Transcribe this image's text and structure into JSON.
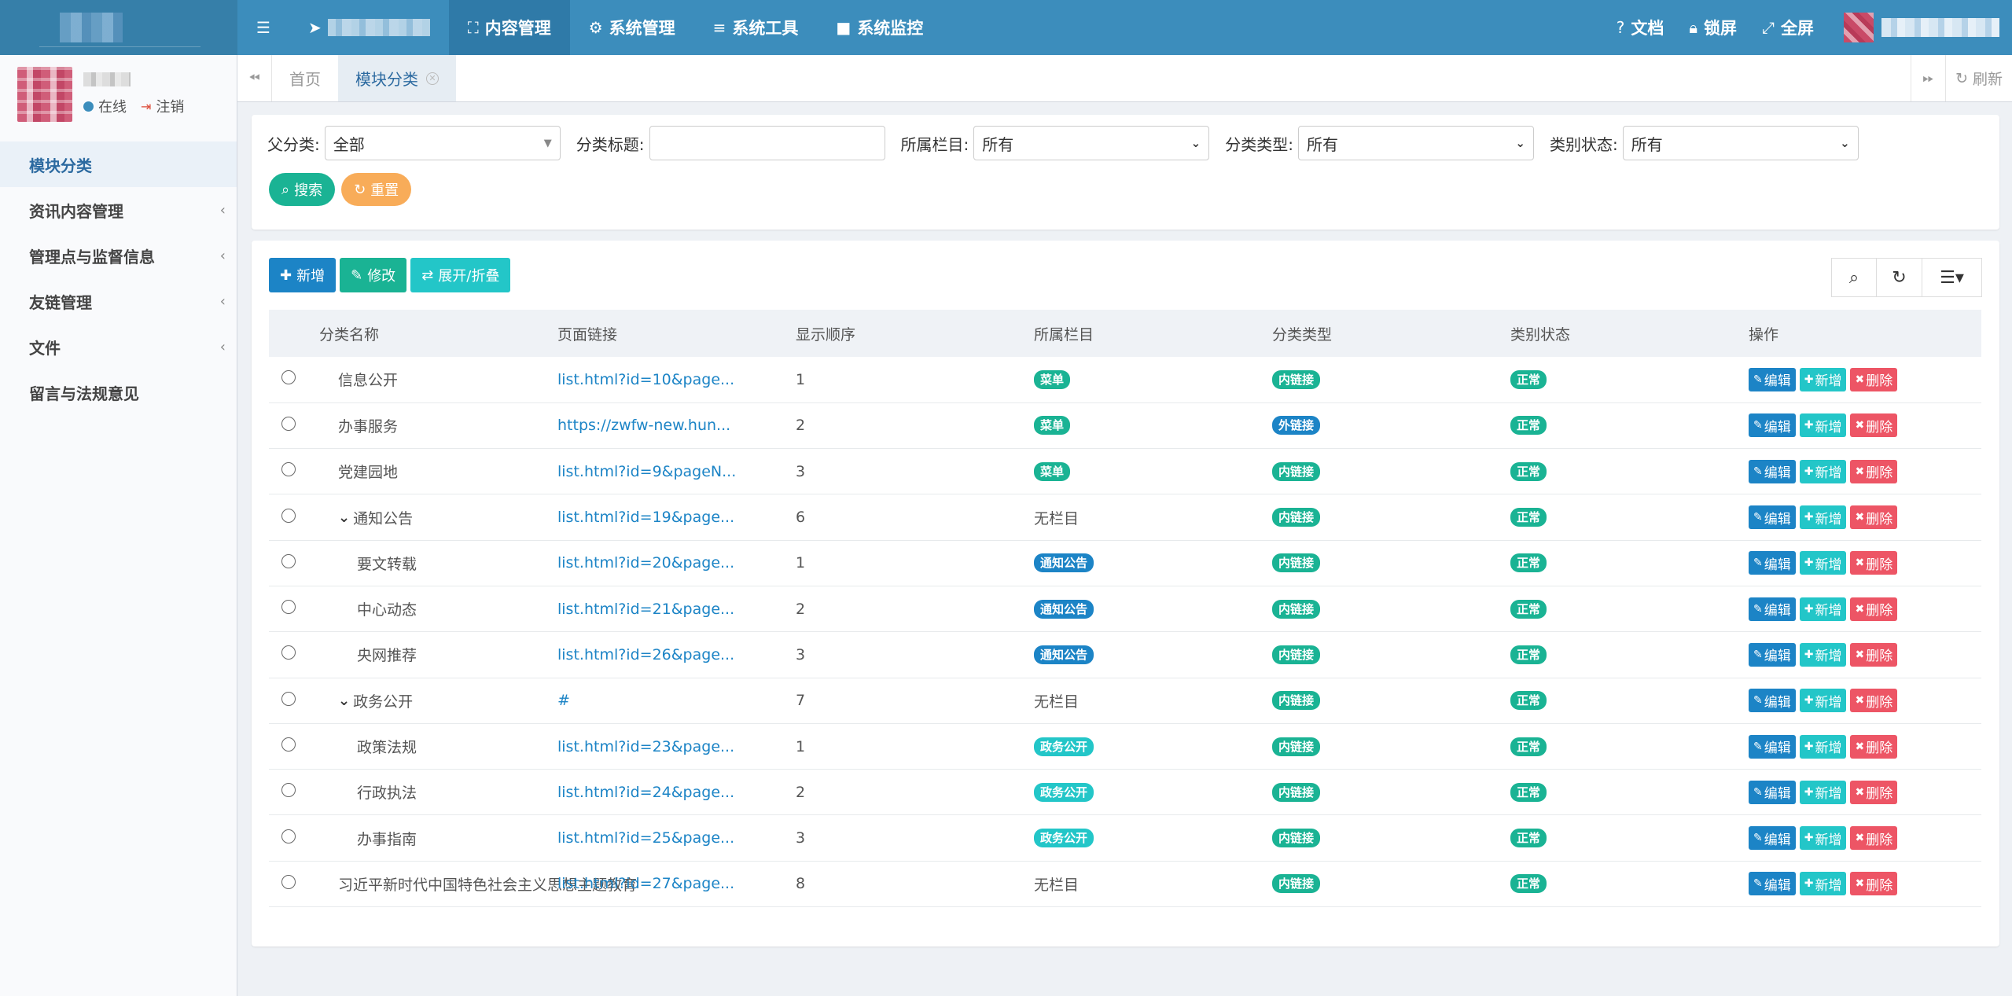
{
  "topbar": {
    "nav": [
      {
        "label": "内容管理",
        "icon": "content-icon"
      },
      {
        "label": "系统管理",
        "icon": "gear-icon"
      },
      {
        "label": "系统工具",
        "icon": "list-icon"
      },
      {
        "label": "系统监控",
        "icon": "camera-icon"
      }
    ],
    "right": [
      {
        "label": "文档",
        "icon": "question-icon"
      },
      {
        "label": "锁屏",
        "icon": "lock-icon"
      },
      {
        "label": "全屏",
        "icon": "fullscreen-icon"
      }
    ]
  },
  "sidebar": {
    "status_online": "在线",
    "logout": "注销",
    "items": [
      {
        "label": "模块分类",
        "active": true,
        "has_children": false
      },
      {
        "label": "资讯内容管理",
        "active": false,
        "has_children": true
      },
      {
        "label": "管理点与监督信息",
        "active": false,
        "has_children": true
      },
      {
        "label": "友链管理",
        "active": false,
        "has_children": true
      },
      {
        "label": "文件",
        "active": false,
        "has_children": true
      },
      {
        "label": "留言与法规意见",
        "active": false,
        "has_children": false
      }
    ]
  },
  "tabs": {
    "home": "首页",
    "current": "模块分类",
    "refresh": "刷新"
  },
  "search": {
    "parent_label": "父分类:",
    "parent_value": "全部",
    "title_label": "分类标题:",
    "title_value": "",
    "column_label": "所属栏目:",
    "column_value": "所有",
    "type_label": "分类类型:",
    "type_value": "所有",
    "status_label": "类别状态:",
    "status_value": "所有",
    "search_btn": "搜索",
    "reset_btn": "重置"
  },
  "toolbar": {
    "add": "新增",
    "edit": "修改",
    "expand": "展开/折叠"
  },
  "table": {
    "headers": [
      "分类名称",
      "页面链接",
      "显示顺序",
      "所属栏目",
      "分类类型",
      "类别状态",
      "操作"
    ],
    "ops": {
      "edit": "编辑",
      "add": "新增",
      "del": "删除"
    },
    "rows": [
      {
        "name": "信息公开",
        "level": 0,
        "tree": "",
        "link": "list.html?id=10&page...",
        "order": "1",
        "column": "菜单",
        "column_style": "green",
        "type": "内链接",
        "type_style": "green",
        "status": "正常"
      },
      {
        "name": "办事服务",
        "level": 0,
        "tree": "",
        "link": "https://zwfw-new.hun...",
        "order": "2",
        "column": "菜单",
        "column_style": "green",
        "type": "外链接",
        "type_style": "blue",
        "status": "正常"
      },
      {
        "name": "党建园地",
        "level": 0,
        "tree": "",
        "link": "list.html?id=9&pageN...",
        "order": "3",
        "column": "菜单",
        "column_style": "green",
        "type": "内链接",
        "type_style": "green",
        "status": "正常"
      },
      {
        "name": "通知公告",
        "level": 0,
        "tree": "⌄",
        "link": "list.html?id=19&page...",
        "order": "6",
        "column": "无栏目",
        "column_style": "text",
        "type": "内链接",
        "type_style": "green",
        "status": "正常"
      },
      {
        "name": "要文转载",
        "level": 1,
        "tree": "",
        "link": "list.html?id=20&page...",
        "order": "1",
        "column": "通知公告",
        "column_style": "blue",
        "type": "内链接",
        "type_style": "green",
        "status": "正常"
      },
      {
        "name": "中心动态",
        "level": 1,
        "tree": "",
        "link": "list.html?id=21&page...",
        "order": "2",
        "column": "通知公告",
        "column_style": "blue",
        "type": "内链接",
        "type_style": "green",
        "status": "正常"
      },
      {
        "name": "央网推荐",
        "level": 1,
        "tree": "",
        "link": "list.html?id=26&page...",
        "order": "3",
        "column": "通知公告",
        "column_style": "blue",
        "type": "内链接",
        "type_style": "green",
        "status": "正常"
      },
      {
        "name": "政务公开",
        "level": 0,
        "tree": "⌄",
        "link": "#",
        "order": "7",
        "column": "无栏目",
        "column_style": "text",
        "type": "内链接",
        "type_style": "green",
        "status": "正常"
      },
      {
        "name": "政策法规",
        "level": 1,
        "tree": "",
        "link": "list.html?id=23&page...",
        "order": "1",
        "column": "政务公开",
        "column_style": "cyan",
        "type": "内链接",
        "type_style": "green",
        "status": "正常"
      },
      {
        "name": "行政执法",
        "level": 1,
        "tree": "",
        "link": "list.html?id=24&page...",
        "order": "2",
        "column": "政务公开",
        "column_style": "cyan",
        "type": "内链接",
        "type_style": "green",
        "status": "正常"
      },
      {
        "name": "办事指南",
        "level": 1,
        "tree": "",
        "link": "list.html?id=25&page...",
        "order": "3",
        "column": "政务公开",
        "column_style": "cyan",
        "type": "内链接",
        "type_style": "green",
        "status": "正常"
      },
      {
        "name": "习近平新时代中国特色社会主义思想主题教育",
        "level": 0,
        "tree": "",
        "link": "list.html?id=27&page...",
        "order": "8",
        "column": "无栏目",
        "column_style": "text",
        "type": "内链接",
        "type_style": "green",
        "status": "正常"
      }
    ]
  },
  "colors": {
    "topbar": "#3c8dbc",
    "green": "#1ab394",
    "blue": "#1c84c6",
    "cyan": "#23c6c8",
    "red": "#ed5565",
    "orange": "#f8ac59"
  }
}
